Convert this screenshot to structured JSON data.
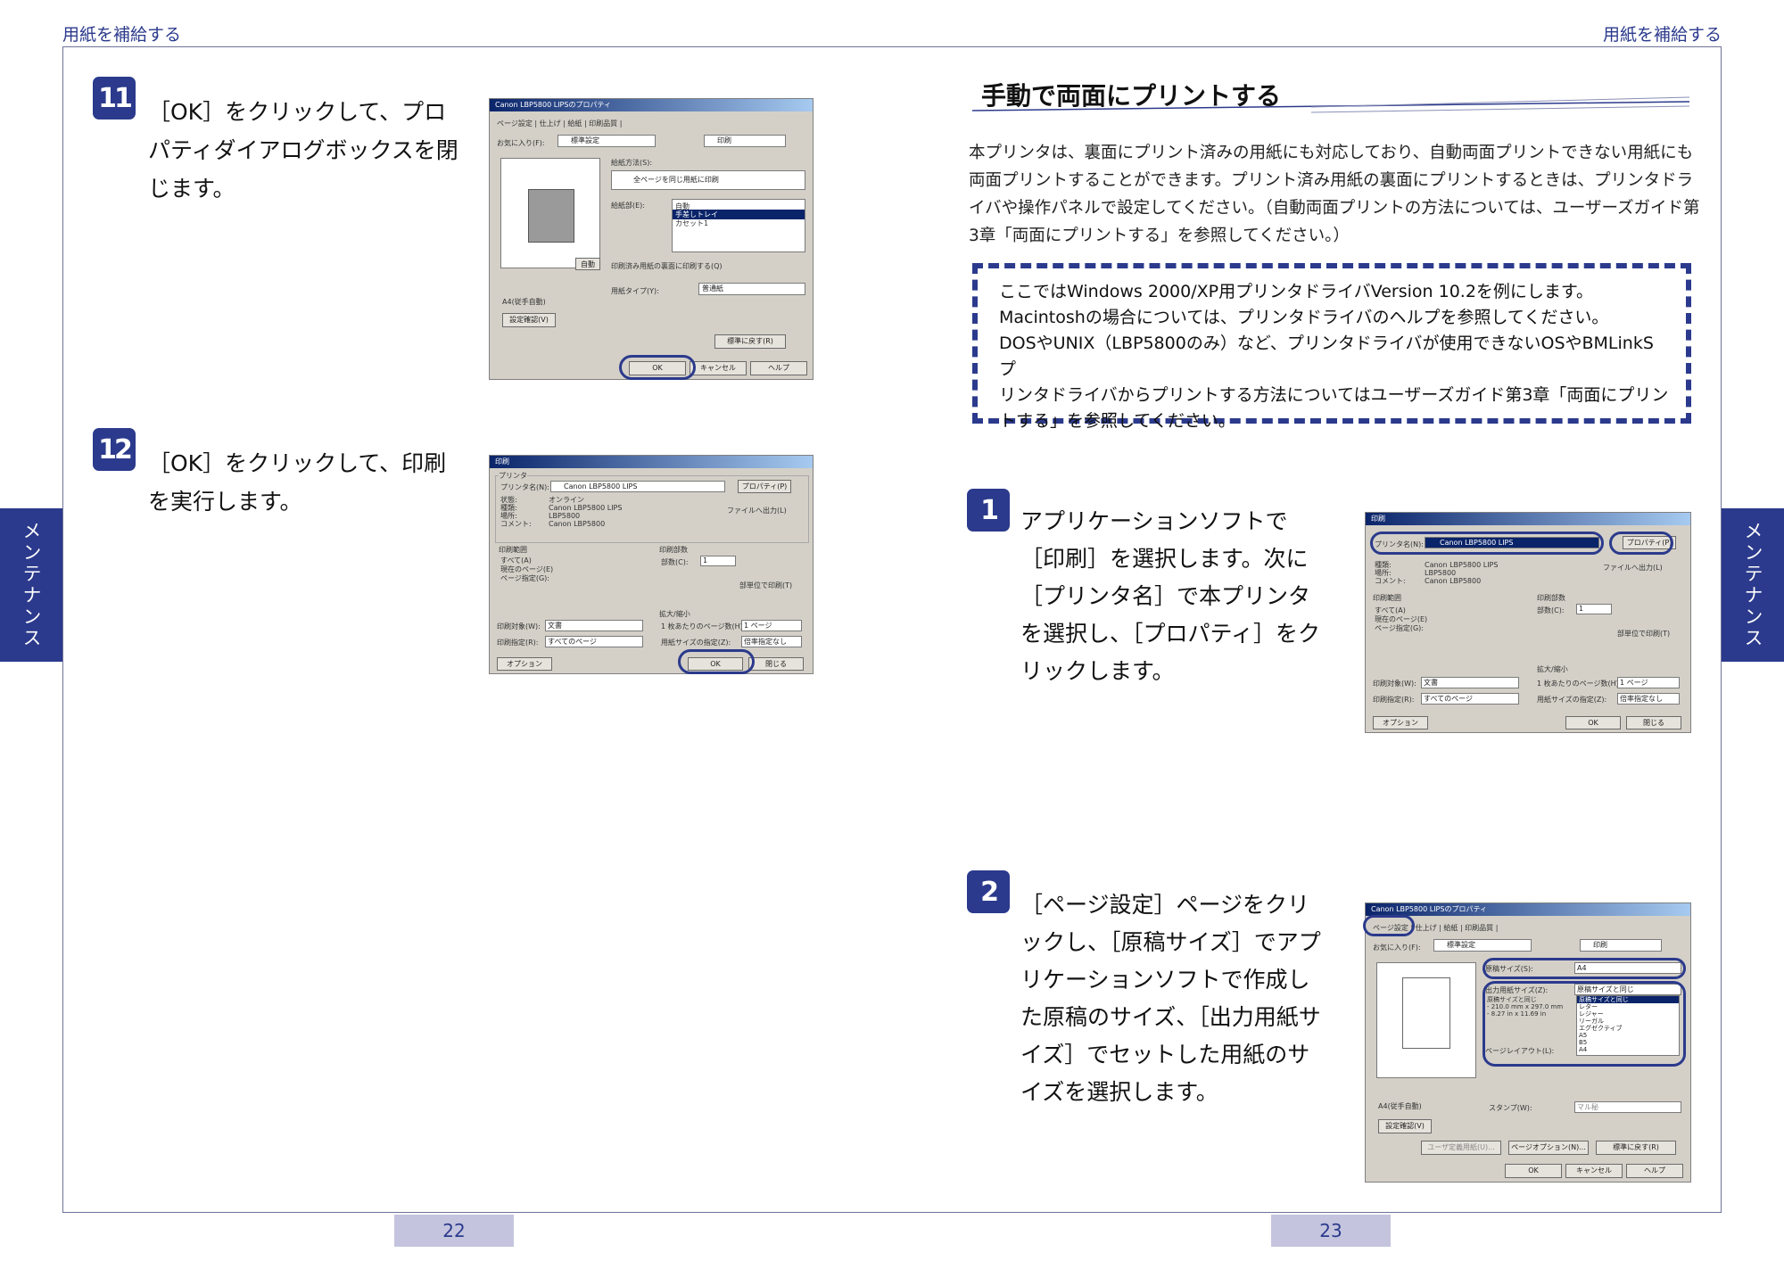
{
  "header": {
    "left": "用紙を補給する",
    "right": "用紙を補給する"
  },
  "side_tab": {
    "left": "メンテナンス",
    "right": "メンテナンス"
  },
  "page_numbers": {
    "left": "22",
    "right": "23"
  },
  "left_steps": [
    {
      "num": "11",
      "text": "［OK］をクリックして、プロパティダイアログボックスを閉じます。"
    },
    {
      "num": "12",
      "text": "［OK］をクリックして、印刷を実行します。"
    }
  ],
  "section": {
    "title": "手動で両面にプリントする",
    "paragraph": "本プリンタは、裏面にプリント済みの用紙にも対応しており、自動両面プリントできない用紙にも両面プリントすることができます。プリント済み用紙の裏面にプリントするときは、プリンタドライバや操作パネルで設定してください。（自動両面プリントの方法については、ユーザーズガイド第3章「両面にプリントする」を参照してください。）",
    "note_lines": [
      "ここではWindows 2000/XP用プリンタドライバVersion 10.2を例にします。",
      "Macintoshの場合については、プリンタドライバのヘルプを参照してください。",
      "DOSやUNIX（LBP5800のみ）など、プリンタドライバが使用できないOSやBMLinkSプ",
      "リンタドライバからプリントする方法についてはユーザーズガイド第3章「両面にプリン",
      "トする」を参照してください。"
    ]
  },
  "right_steps": [
    {
      "num": "1",
      "text": "アプリケーションソフトで［印刷］を選択します。次に［プリンタ名］で本プリンタを選択し、［プロパティ］をクリックします。"
    },
    {
      "num": "2",
      "text": "［ページ設定］ページをクリックし、［原稿サイズ］でアプリケーションソフトで作成した原稿のサイズ、［出力用紙サイズ］でセットした用紙のサイズを選択します。"
    }
  ],
  "dialogs": {
    "props": {
      "title": "Canon LBP5800 LIPSのプロパティ",
      "tabs": "ページ設定 | 仕上げ | 給紙 | 印刷品質 |",
      "favorite_label": "お気に入り(F):",
      "favorite_value": "標準設定",
      "print_mode": "印刷",
      "feed_method_label": "給紙方法(S):",
      "feed_method_value": "全ページを同じ用紙に印刷",
      "feed_source_label": "給紙部(E):",
      "feed_source_items": [
        "自動",
        "手差しトレイ",
        "カセット1"
      ],
      "auto_badge": "自動",
      "reverse_label": "印刷済み用紙の裏面に印刷する(Q)",
      "paper_type_label": "用紙タイプ(Y):",
      "paper_type_value": "普通紙",
      "a4_label": "A4(従手自動)",
      "confirm_button": "設定確認(V)",
      "restore_button": "標準に戻す(R)",
      "ok": "OK",
      "cancel": "キャンセル",
      "help": "ヘルプ"
    },
    "print": {
      "title": "印刷",
      "printer_group": "プリンタ",
      "printer_name_label": "プリンタ名(N):",
      "printer_name_value": "Canon LBP5800 LIPS",
      "properties_button": "プロパティ(P)",
      "info_labels": [
        "状態:",
        "種類:",
        "場所:",
        "コメント:"
      ],
      "info_values": [
        "オンライン",
        "Canon LBP5800 LIPS",
        "LBP5800",
        "Canon LBP5800"
      ],
      "to_file": "ファイルへ出力(L)",
      "range_group": "印刷範囲",
      "range_all": "すべて(A)",
      "range_current": "現在のページ(E)",
      "range_pages": "ページ指定(G):",
      "copies_group": "印刷部数",
      "copies_label": "部数(C):",
      "copies_value": "1",
      "collate": "部単位で印刷(T)",
      "zoom_group": "拡大/縮小",
      "target_label": "印刷対象(W):",
      "target_value": "文書",
      "pages_label": "印刷指定(R):",
      "pages_value": "すべてのページ",
      "per_sheet_label": "1 枚あたりのページ数(H):",
      "per_sheet_value": "1 ページ",
      "fit_label": "用紙サイズの指定(Z):",
      "fit_value": "倍率指定なし",
      "options_button": "オプション(O)...",
      "ok": "OK",
      "close": "閉じる"
    },
    "page_setup": {
      "title": "Canon LBP5800 LIPSのプロパティ",
      "tabs": "ページ設定 | 仕上げ | 給紙 | 印刷品質 |",
      "orig_size_label": "原稿サイズ(S):",
      "orig_size_value": "A4",
      "out_size_label": "出力用紙サイズ(Z):",
      "out_size_value": "原稿サイズと同じ",
      "list_items": [
        "原稿サイズと同じ",
        "レター",
        "レジャー",
        "リーガル",
        "エグゼクティブ",
        "A5",
        "B5",
        "A4"
      ],
      "size_info": [
        "原稿サイズと同じ",
        "- 210.0 mm x 297.0 mm",
        "- 8.27 in x 11.69 in"
      ],
      "layout_label": "ページレイアウト(L):",
      "stamp_label": "スタンプ(W):",
      "stamp_value": "マル秘",
      "a4_label": "A4(従手自動)",
      "confirm_button": "設定確認(V)",
      "user_size_button": "ユーザ定義用紙(U)...",
      "page_opt_button": "ページオプション(N)...",
      "restore_button": "標準に戻す(R)",
      "ok": "OK",
      "cancel": "キャンセル",
      "help": "ヘルプ"
    }
  }
}
